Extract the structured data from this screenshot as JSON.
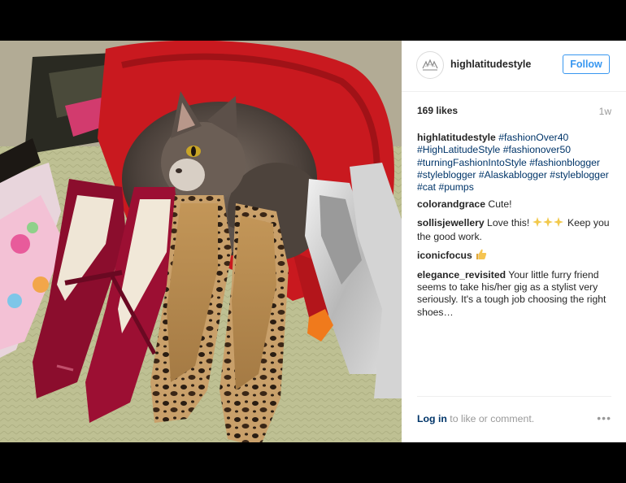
{
  "post": {
    "username": "highlatitudestyle",
    "follow_label": "Follow",
    "likes": "169 likes",
    "age": "1w",
    "caption": {
      "author": "highlatitudestyle",
      "tags": [
        "#fashionOver40",
        "#HighLatitudeStyle",
        "#fashionover50",
        "#turningFashionIntoStyle",
        "#fashionblogger",
        "#styleblogger",
        "#Alaskablogger",
        "#styleblogger",
        "#cat",
        "#pumps"
      ]
    },
    "comments": [
      {
        "author": "colorandgrace",
        "text_before": "Cute!",
        "emoji": "",
        "text_after": ""
      },
      {
        "author": "sollisjewellery",
        "text_before": "Love this!",
        "emoji": "sparkles-icon",
        "text_after": "Keep you the good work."
      },
      {
        "author": "iconicfocus",
        "text_before": "",
        "emoji": "thumbs-up-icon",
        "text_after": ""
      },
      {
        "author": "elegance_revisited",
        "text_before": "Your little furry friend seems to take his/her gig as a stylist very seriously. It's a tough job choosing the right shoes…",
        "emoji": "",
        "text_after": ""
      }
    ],
    "footer": {
      "login_link": "Log in",
      "login_suffix": " to like or comment.",
      "more_label": "•••"
    }
  },
  "photo_subject": "Cat on red pillow beside pumps",
  "colors": {
    "link": "#003569",
    "follow": "#3897f0",
    "muted": "#999999"
  }
}
